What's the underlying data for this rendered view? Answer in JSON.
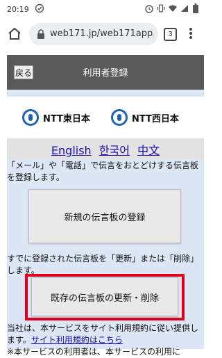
{
  "statusbar": {
    "time": "20:19"
  },
  "browser": {
    "url": "web171.jp/web171app.",
    "tab_count": "3"
  },
  "header": {
    "back_label": "戻る",
    "title": "利用者登録"
  },
  "logos": {
    "east": "NTT東日本",
    "west": "NTT西日本"
  },
  "languages": {
    "english": "English",
    "korean": "한국어",
    "chinese": "中文"
  },
  "register": {
    "description": "「メール」や「電話」で伝言をおとどけする伝言板を登録します。",
    "button_label": "新規の伝言板の登録"
  },
  "existing": {
    "description": "すでに登録された伝言板を「更新」または「削除」します。",
    "button_label": "既存の伝言板の更新・削除"
  },
  "terms": {
    "text": "当社は、本サービスをサイト利用規約に従い提供します。",
    "link": "サイト利用規約はこちら",
    "note": "※本サービスの利用者は、本サービスの利用に"
  },
  "colors": {
    "header_bg": "#5a5a5a",
    "content_bg": "#dde6f5",
    "highlight": "#e0001b",
    "link": "#1a0dab"
  }
}
